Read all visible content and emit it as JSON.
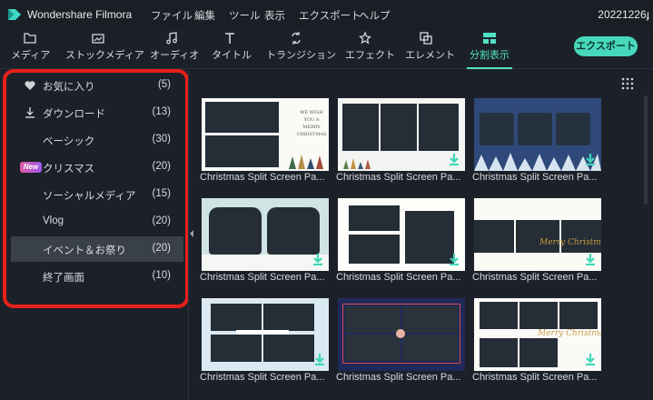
{
  "app": {
    "name": "Wondershare Filmora",
    "project": "20221226ɟ"
  },
  "menu": [
    "ファイル",
    "編集",
    "ツール",
    "表示",
    "エクスポート",
    "ヘルプ"
  ],
  "toolbar": {
    "tabs": [
      {
        "label": "メディア",
        "icon": "folder-icon"
      },
      {
        "label": "ストックメディア",
        "icon": "stock-media-icon"
      },
      {
        "label": "オーディオ",
        "icon": "music-note-icon"
      },
      {
        "label": "タイトル",
        "icon": "text-t-icon"
      },
      {
        "label": "トランジション",
        "icon": "transition-icon"
      },
      {
        "label": "エフェクト",
        "icon": "effects-star-icon"
      },
      {
        "label": "エレメント",
        "icon": "elements-icon"
      },
      {
        "label": "分割表示",
        "icon": "split-screen-icon"
      }
    ],
    "active_tab": "分割表示",
    "export_label": "エクスポート"
  },
  "sidebar": {
    "items": [
      {
        "label": "お気に入り",
        "count": "(5)",
        "icon": "heart-icon"
      },
      {
        "label": "ダウンロード",
        "count": "(13)",
        "icon": "download-icon"
      },
      {
        "label": "ベーシック",
        "count": "(30)"
      },
      {
        "label": "クリスマス",
        "count": "(20)",
        "badge": "New"
      },
      {
        "label": "ソーシャルメディア",
        "count": "(15)"
      },
      {
        "label": "Vlog",
        "count": "(20)"
      },
      {
        "label": "イベント＆お祭り",
        "count": "(20)"
      },
      {
        "label": "終了画面",
        "count": "(10)"
      }
    ],
    "selected": "イベント＆お祭り"
  },
  "templates": [
    {
      "title": "Christmas Split Screen Pa...",
      "thumb_text": "WE WISH YOU A MERRY CHRISTMAS"
    },
    {
      "title": "Christmas Split Screen Pa..."
    },
    {
      "title": "Christmas Split Screen Pa..."
    },
    {
      "title": "Christmas Split Screen Pa..."
    },
    {
      "title": "Christmas Split Screen Pa..."
    },
    {
      "title": "Christmas Split Screen Pa...",
      "thumb_text": "Merry Christmas"
    },
    {
      "title": "Christmas Split Screen Pa..."
    },
    {
      "title": "Christmas Split Screen Pa..."
    },
    {
      "title": "Christmas Split Screen Pa...",
      "thumb_text": "Merry Christmas"
    }
  ],
  "colors": {
    "accent": "#52e1c4",
    "highlight_border": "#e8201a",
    "background": "#1c2129",
    "selected_row": "#3a4049"
  }
}
